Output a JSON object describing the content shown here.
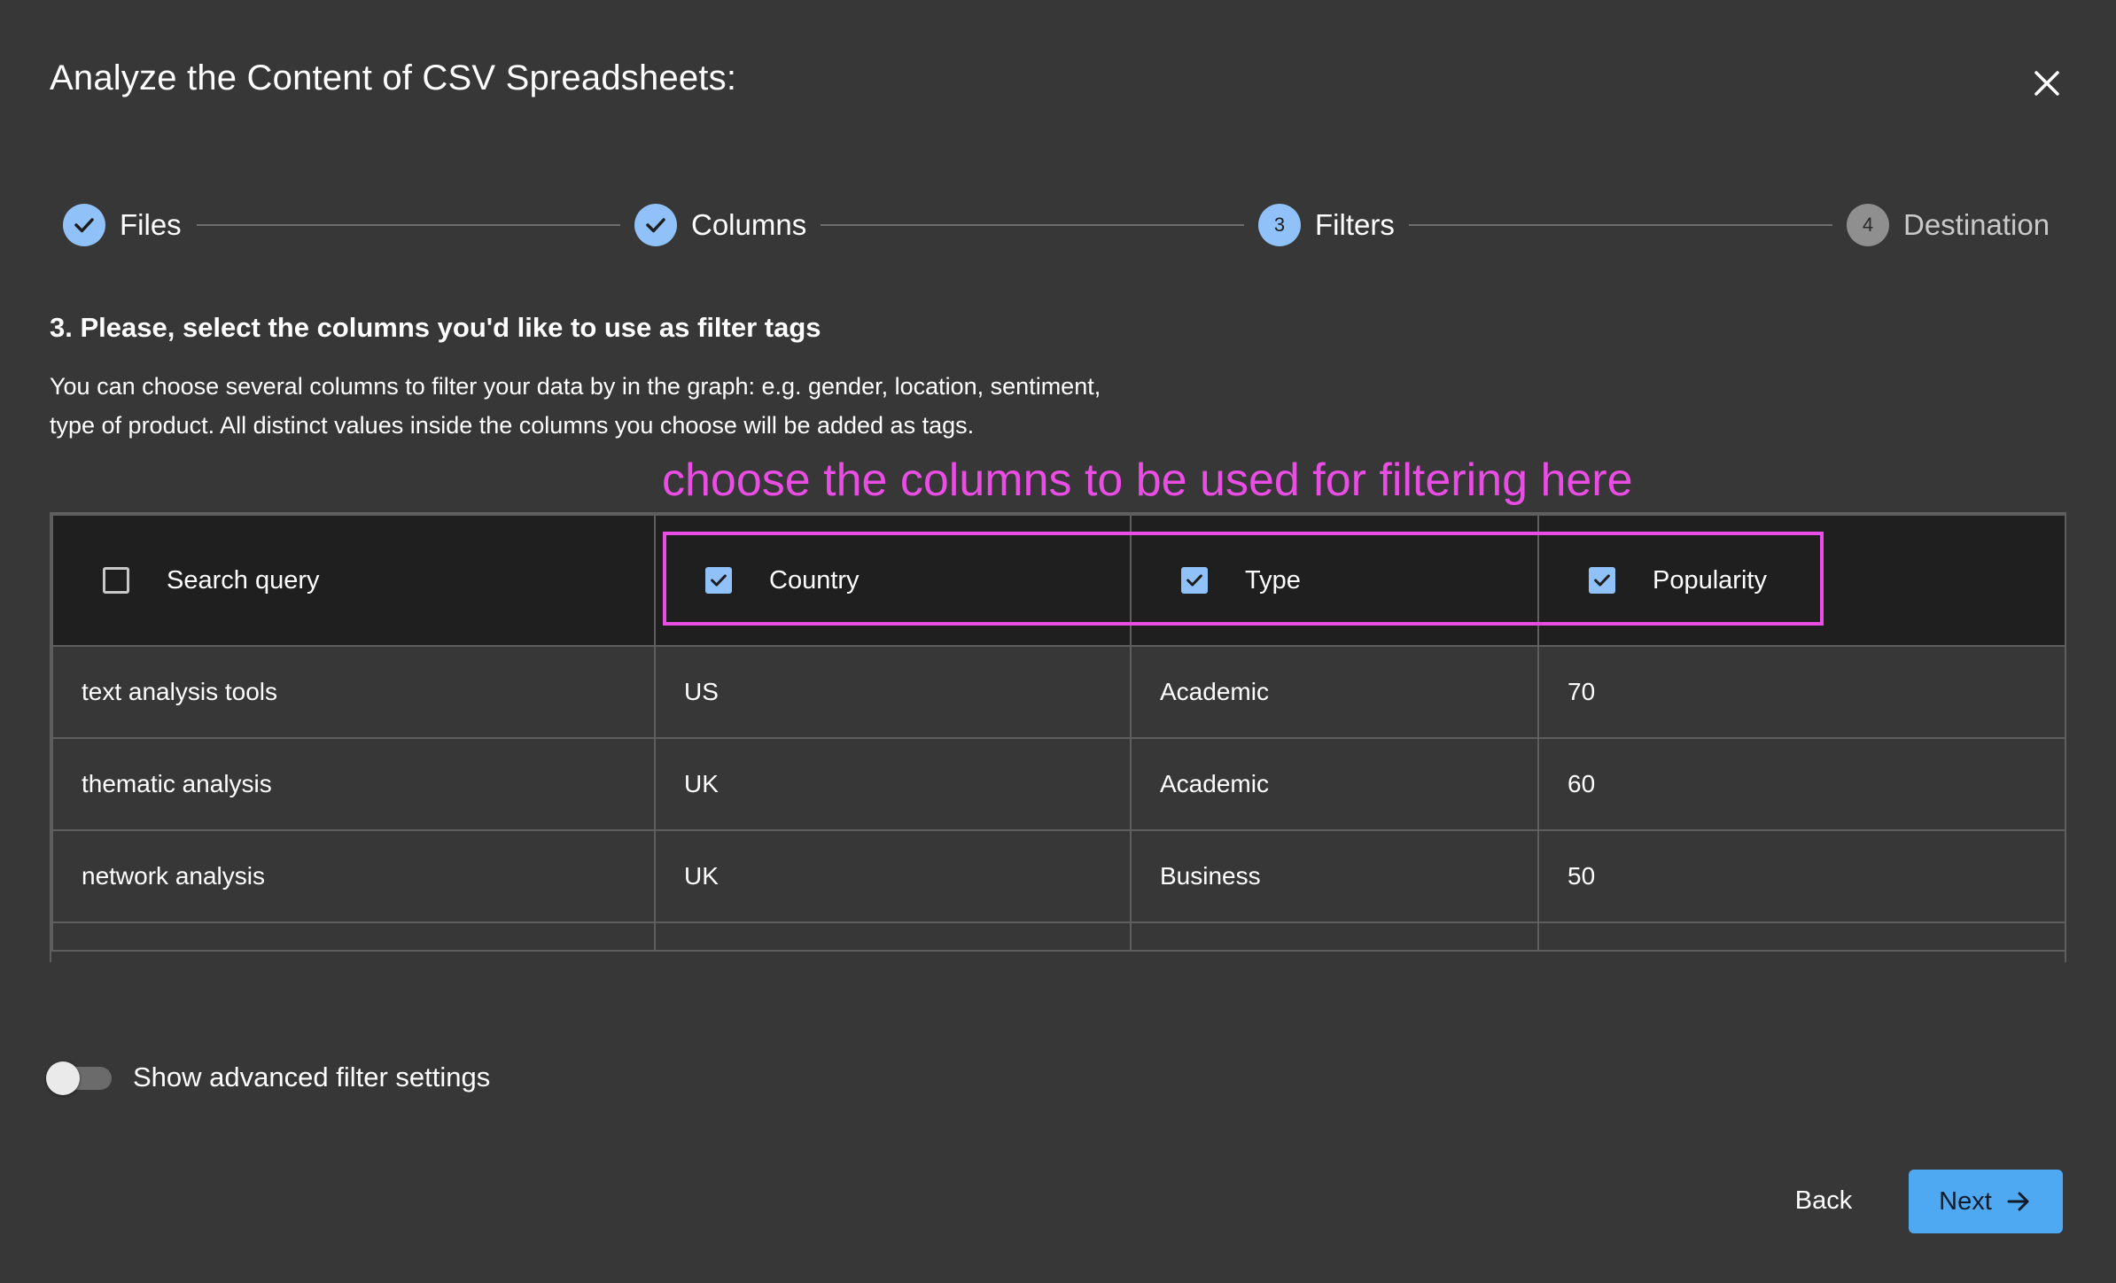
{
  "dialog": {
    "title": "Analyze the Content of CSV Spreadsheets:",
    "close_icon": "close-icon"
  },
  "stepper": {
    "steps": [
      {
        "label": "Files",
        "state": "done",
        "marker": ""
      },
      {
        "label": "Columns",
        "state": "done",
        "marker": ""
      },
      {
        "label": "Filters",
        "state": "active",
        "marker": "3"
      },
      {
        "label": "Destination",
        "state": "todo",
        "marker": "4"
      }
    ]
  },
  "section": {
    "heading": "3. Please, select the columns you'd like to use as filter tags",
    "description": "You can choose several columns to filter your data by in the graph: e.g. gender, location, sentiment, type of product. All distinct values inside the columns you choose will be added as tags."
  },
  "annotation": "choose the columns to be used for filtering here",
  "table": {
    "columns": [
      {
        "label": "Search query",
        "checked": false
      },
      {
        "label": "Country",
        "checked": true
      },
      {
        "label": "Type",
        "checked": true
      },
      {
        "label": "Popularity",
        "checked": true
      }
    ],
    "rows": [
      [
        "text analysis tools",
        "US",
        "Academic",
        "70"
      ],
      [
        "thematic analysis",
        "UK",
        "Academic",
        "60"
      ],
      [
        "network analysis",
        "UK",
        "Business",
        "50"
      ]
    ]
  },
  "advanced_toggle": {
    "label": "Show advanced filter settings",
    "on": false
  },
  "footer": {
    "back_label": "Back",
    "next_label": "Next"
  },
  "colors": {
    "background": "#373737",
    "accent": "#90c2f9",
    "primary_button": "#4ea8f2",
    "annotation": "#e94de3"
  }
}
